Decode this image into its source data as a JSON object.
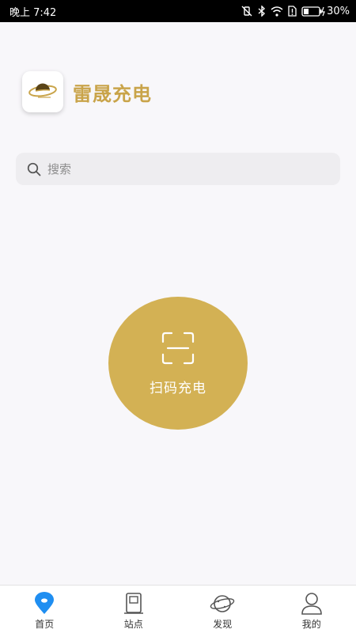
{
  "status_bar": {
    "time": "晚上 7:42",
    "battery": "30%"
  },
  "brand": {
    "name": "雷晟充电",
    "icon": "planet-logo-icon"
  },
  "search": {
    "placeholder": "搜索",
    "icon": "search-icon"
  },
  "scan": {
    "label": "扫码充电",
    "icon": "scan-frame-icon"
  },
  "tabs": [
    {
      "label": "首页",
      "icon": "map-pin-icon",
      "active": true
    },
    {
      "label": "站点",
      "icon": "charging-station-icon",
      "active": false
    },
    {
      "label": "发现",
      "icon": "planet-icon",
      "active": false
    },
    {
      "label": "我的",
      "icon": "person-icon",
      "active": false
    }
  ],
  "colors": {
    "accent": "#d3b154",
    "brand_text": "#c9a44a",
    "active_tab": "#1f8ef1"
  }
}
